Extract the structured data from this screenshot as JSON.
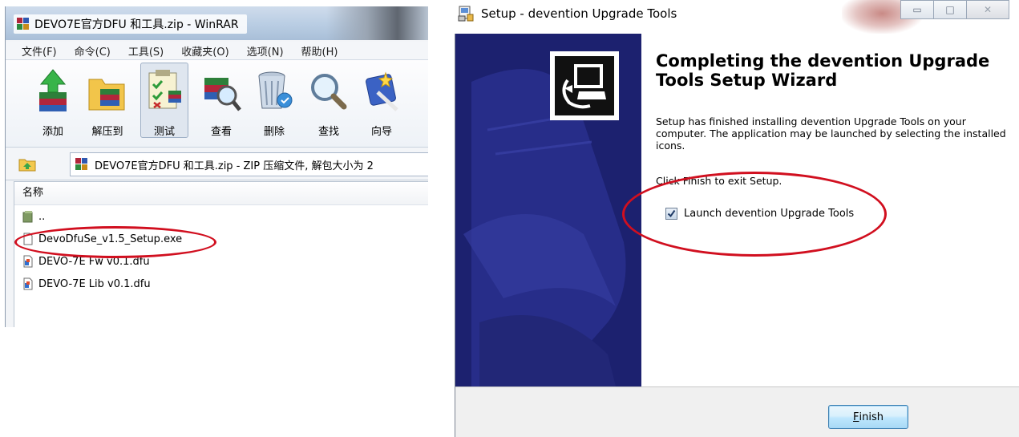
{
  "winrar": {
    "title": "DEVO7E官方DFU 和工具.zip - WinRAR",
    "menu": [
      "文件(F)",
      "命令(C)",
      "工具(S)",
      "收藏夹(O)",
      "选项(N)",
      "帮助(H)"
    ],
    "toolbar": [
      {
        "label": "添加",
        "icon": "add-archive-icon"
      },
      {
        "label": "解压到",
        "icon": "extract-to-icon"
      },
      {
        "label": "测试",
        "icon": "test-icon"
      },
      {
        "label": "查看",
        "icon": "view-icon"
      },
      {
        "label": "删除",
        "icon": "delete-icon"
      },
      {
        "label": "查找",
        "icon": "find-icon"
      },
      {
        "label": "向导",
        "icon": "wizard-icon"
      }
    ],
    "address": "DEVO7E官方DFU 和工具.zip - ZIP 压缩文件, 解包大小为 2",
    "column_name": "名称",
    "files": [
      {
        "name": "..",
        "icon": "folder-up-icon"
      },
      {
        "name": "DevoDfuSe_v1.5_Setup.exe",
        "icon": "exe-file-icon"
      },
      {
        "name": "DEVO-7E Fw v0.1.dfu",
        "icon": "dfu-file-icon"
      },
      {
        "name": "DEVO-7E Lib v0.1.dfu",
        "icon": "dfu-file-icon"
      }
    ]
  },
  "setup": {
    "title": "Setup - devention Upgrade Tools",
    "heading": "Completing the devention Upgrade Tools Setup Wizard",
    "body": "Setup has finished installing devention Upgrade Tools on your computer. The application may be launched by selecting the installed icons.",
    "click_text": "Click Finish to exit Setup.",
    "launch_label": "Launch devention Upgrade Tools",
    "launch_checked": true,
    "finish_mnemonic": "F",
    "finish_rest": "inish"
  },
  "colors": {
    "annotation": "#d10f1f",
    "banner": "#1b1f6e",
    "winrar_chrome": "#b9cde3"
  }
}
